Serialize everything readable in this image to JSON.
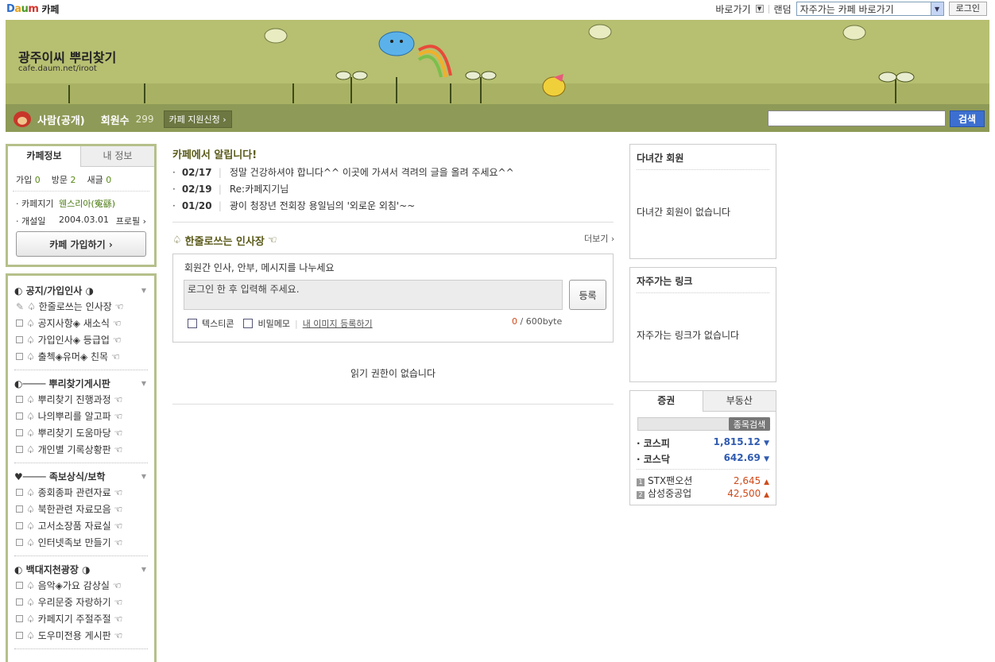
{
  "topbar": {
    "logo_text": "Daum",
    "cafe_label": "카페",
    "shortcut_label": "바로가기",
    "random_label": "랜덤",
    "favorites_select": "자주가는 카페 바로가기",
    "login_label": "로그인"
  },
  "banner": {
    "cafe_name": "광주이씨 뿌리찾기",
    "cafe_url": "cafe.daum.net/iroot"
  },
  "navbar": {
    "public_label": "사람(공개)",
    "members_label": "회원수",
    "members_count": "299",
    "support_label": "카페 지원신청 ›",
    "search_button": "검색"
  },
  "cafe_info": {
    "tab_active": "카페정보",
    "tab_inactive": "내 정보",
    "join_label": "가입",
    "join_count": "0",
    "visit_label": "방문",
    "visit_count": "2",
    "new_label": "새글",
    "new_count": "0",
    "owner_label": "· 카페지기",
    "owner_value": "웬스리아(寃繇)",
    "founded_label": "· 개설일",
    "founded_value": "2004.03.01",
    "profile_label": "프로필 ›",
    "join_button": "카페 가입하기 ›"
  },
  "menu": {
    "groups": [
      {
        "title": "◐ 공지/가입인사 ◑",
        "items": [
          "♤ 한줄로쓰는 인사장 ☜",
          "♤ 공지사항◈ 새소식 ☜",
          "♤ 가입인사◈ 등급업 ☜",
          "♤ 출첵◈유머◈ 친목 ☜"
        ]
      },
      {
        "title": "◐──── 뿌리찾기게시판",
        "items": [
          "♤ 뿌리찾기 진행과정 ☜",
          "♤ 나의뿌리를 알고파 ☜",
          "♤ 뿌리찾기 도움마당 ☜",
          "♤ 개인별 기록상황판 ☜"
        ]
      },
      {
        "title": "♥──── 족보상식/보학",
        "items": [
          "♤ 종회종파 관련자료 ☜",
          "♤ 북한관련 자료모음 ☜",
          "♤ 고서소장품 자료실 ☜",
          "♤ 인터넷족보 만들기 ☜"
        ]
      },
      {
        "title": "◐ 백대지천광장 ◑",
        "items": [
          "♤ 음악◈가요 감상실 ☜",
          "♤ 우리문중 자랑하기 ☜",
          "♤ 카페지기 주절주절 ☜",
          "♤ 도우미전용 게시판 ☜"
        ]
      }
    ]
  },
  "notices": {
    "title": "카페에서 알립니다!",
    "items": [
      {
        "date": "02/17",
        "text": "정말 건강하셔야 합니다^^ 이곳에 가셔서 격려의 글을 올려 주세요^^"
      },
      {
        "date": "02/19",
        "text": "Re:카페지기님"
      },
      {
        "date": "01/20",
        "text": "광이 청장년 전회장 용일님의 '외로운 외침'~~"
      }
    ]
  },
  "guestbook": {
    "title": "한줄로쓰는 인사장",
    "more_label": "더보기 ›",
    "hint": "회원간 인사, 안부, 메시지를 나누세요",
    "textarea_placeholder": "로그인 한 후 입력해 주세요.",
    "register_label": "등록",
    "emoticon_label": "텍스티콘",
    "secret_label": "비밀메모",
    "image_link": "내 이미지 등록하기",
    "byte_count": "0",
    "byte_limit": " / 600byte"
  },
  "no_permission": "읽기 권한이 없습니다",
  "right": {
    "visitors_title": "다녀간 회원",
    "visitors_empty": "다녀간 회원이 없습니다",
    "links_title": "자주가는 링크",
    "links_empty": "자주가는 링크가 없습니다",
    "tab_stock": "증권",
    "tab_realestate": "부동산",
    "stock_search": "종목검색",
    "indices": [
      {
        "name": "· 코스피",
        "value": "1,815.12"
      },
      {
        "name": "· 코스닥",
        "value": "642.69"
      }
    ],
    "stocks": [
      {
        "rank": "1",
        "name": "STX팬오션",
        "value": "2,645"
      },
      {
        "rank": "2",
        "name": "삼성중공업",
        "value": "42,500"
      }
    ]
  },
  "colors": {
    "banner_bg": "#b7bf71",
    "nav_bg": "#8e9a57",
    "border_green": "#b5c08a",
    "search_blue": "#3d6fd0"
  }
}
